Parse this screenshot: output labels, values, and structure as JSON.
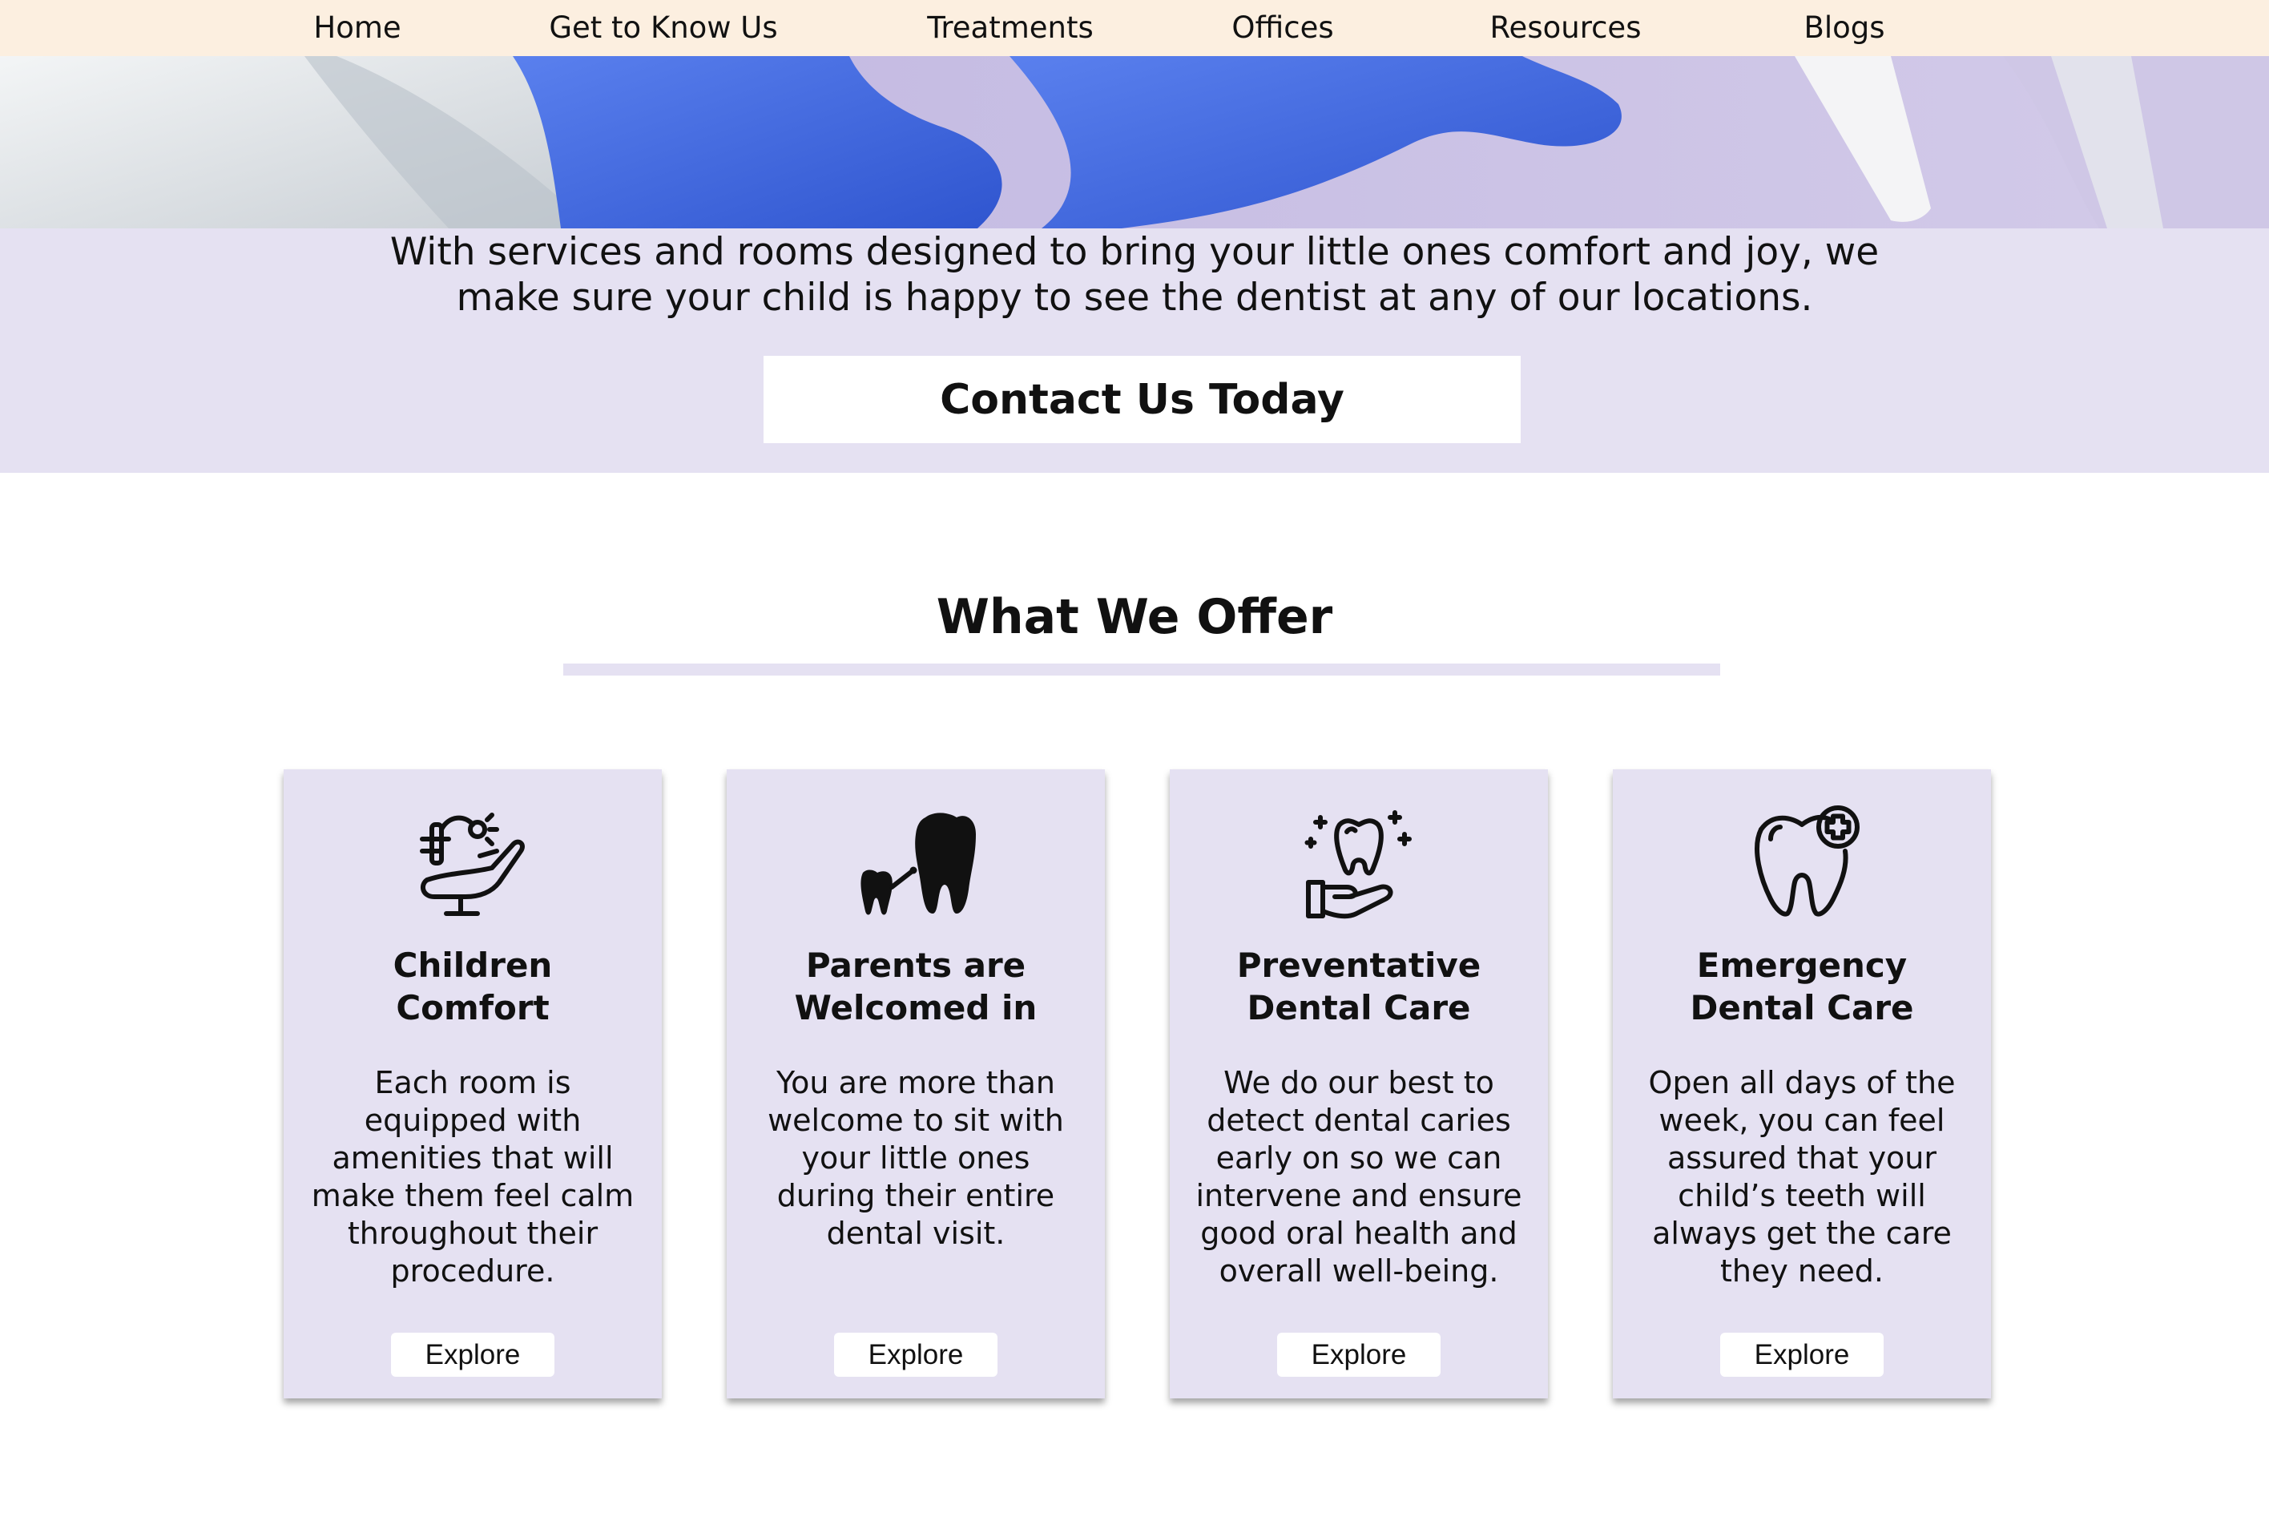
{
  "nav": {
    "items": [
      {
        "label": "Home"
      },
      {
        "label": "Get to Know Us"
      },
      {
        "label": "Treatments"
      },
      {
        "label": "Offices"
      },
      {
        "label": "Resources"
      },
      {
        "label": "Blogs"
      }
    ]
  },
  "hero": {
    "text_line1": "With services and rooms designed to bring your little ones comfort and joy, we",
    "text_line2": "make sure your child is happy to see the dentist at any of our locations.",
    "cta_label": "Contact Us Today"
  },
  "offer": {
    "title": "What We Offer",
    "cards": [
      {
        "icon": "dental-chair-icon",
        "title_line1": "Children",
        "title_line2": "Comfort",
        "desc_lines": [
          "Each room is",
          "equipped with",
          "amenities that will",
          "make them feel calm",
          "throughout their",
          "procedure."
        ],
        "button": "Explore"
      },
      {
        "icon": "parent-child-teeth-icon",
        "title_line1": "Parents are",
        "title_line2": "Welcomed in",
        "desc_lines": [
          "You are more than",
          "welcome to sit with",
          "your little ones",
          "during their entire",
          "dental visit."
        ],
        "button": "Explore"
      },
      {
        "icon": "tooth-in-hand-icon",
        "title_line1": "Preventative",
        "title_line2": "Dental Care",
        "desc_lines": [
          "We do our best to",
          "detect dental caries",
          "early on so we can",
          "intervene and ensure",
          "good oral health and",
          "overall well-being."
        ],
        "button": "Explore"
      },
      {
        "icon": "tooth-medical-cross-icon",
        "title_line1": "Emergency",
        "title_line2": "Dental Care",
        "desc_lines": [
          "Open all days of the",
          "week, you can feel",
          "assured that your",
          "child’s teeth will",
          "always get the care",
          "they need."
        ],
        "button": "Explore"
      }
    ]
  },
  "colors": {
    "nav_bg": "#fcefe0",
    "lavender": "#e5e1f2",
    "glove_blue": "#4d74e8",
    "text": "#111111"
  }
}
